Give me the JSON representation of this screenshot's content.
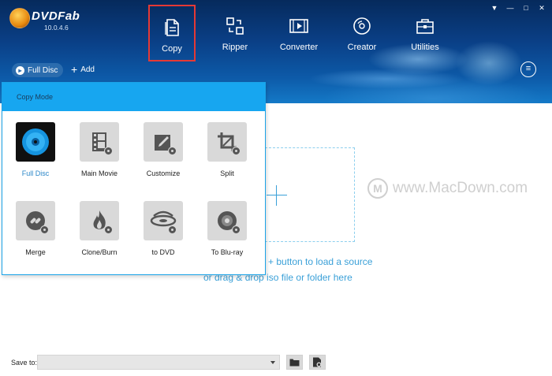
{
  "app": {
    "brand": "DVDFab",
    "version": "10.0.4.6"
  },
  "nav": {
    "items": [
      {
        "label": "Copy",
        "icon": "document-icon",
        "active": true
      },
      {
        "label": "Ripper",
        "icon": "ripper-icon",
        "active": false
      },
      {
        "label": "Converter",
        "icon": "film-icon",
        "active": false
      },
      {
        "label": "Creator",
        "icon": "disc-icon",
        "active": false
      },
      {
        "label": "Utilities",
        "icon": "toolbox-icon",
        "active": false
      }
    ]
  },
  "window_controls": [
    "▼",
    "—",
    "□",
    "✕"
  ],
  "toolbar": {
    "mode_label": "Full Disc",
    "add_label": "Add"
  },
  "popup": {
    "title": "Copy Mode",
    "modes": [
      {
        "label": "Full Disc",
        "icon": "full-disc-icon",
        "selected": true
      },
      {
        "label": "Main Movie",
        "icon": "film-strip-icon",
        "selected": false
      },
      {
        "label": "Customize",
        "icon": "edit-icon",
        "selected": false
      },
      {
        "label": "Split",
        "icon": "split-icon",
        "selected": false
      },
      {
        "label": "Merge",
        "icon": "link-icon",
        "selected": false
      },
      {
        "label": "Clone/Burn",
        "icon": "flame-icon",
        "selected": false
      },
      {
        "label": "to DVD",
        "icon": "dvd-icon",
        "selected": false
      },
      {
        "label": "To Blu-ray",
        "icon": "bluray-icon",
        "selected": false
      }
    ]
  },
  "drop_area": {
    "hint_line_1": "n + button to load a source",
    "hint_line_2": "or drag & drop iso file or folder here"
  },
  "watermark": {
    "logo_letter": "M",
    "text": "www.MacDown.com"
  },
  "bottom": {
    "save_to_label": "Save to:",
    "save_to_value": ""
  },
  "colors": {
    "accent": "#17a6f0",
    "header_dark": "#062a5c",
    "highlight_border": "#e53935",
    "selected_label": "#2a86c8"
  }
}
